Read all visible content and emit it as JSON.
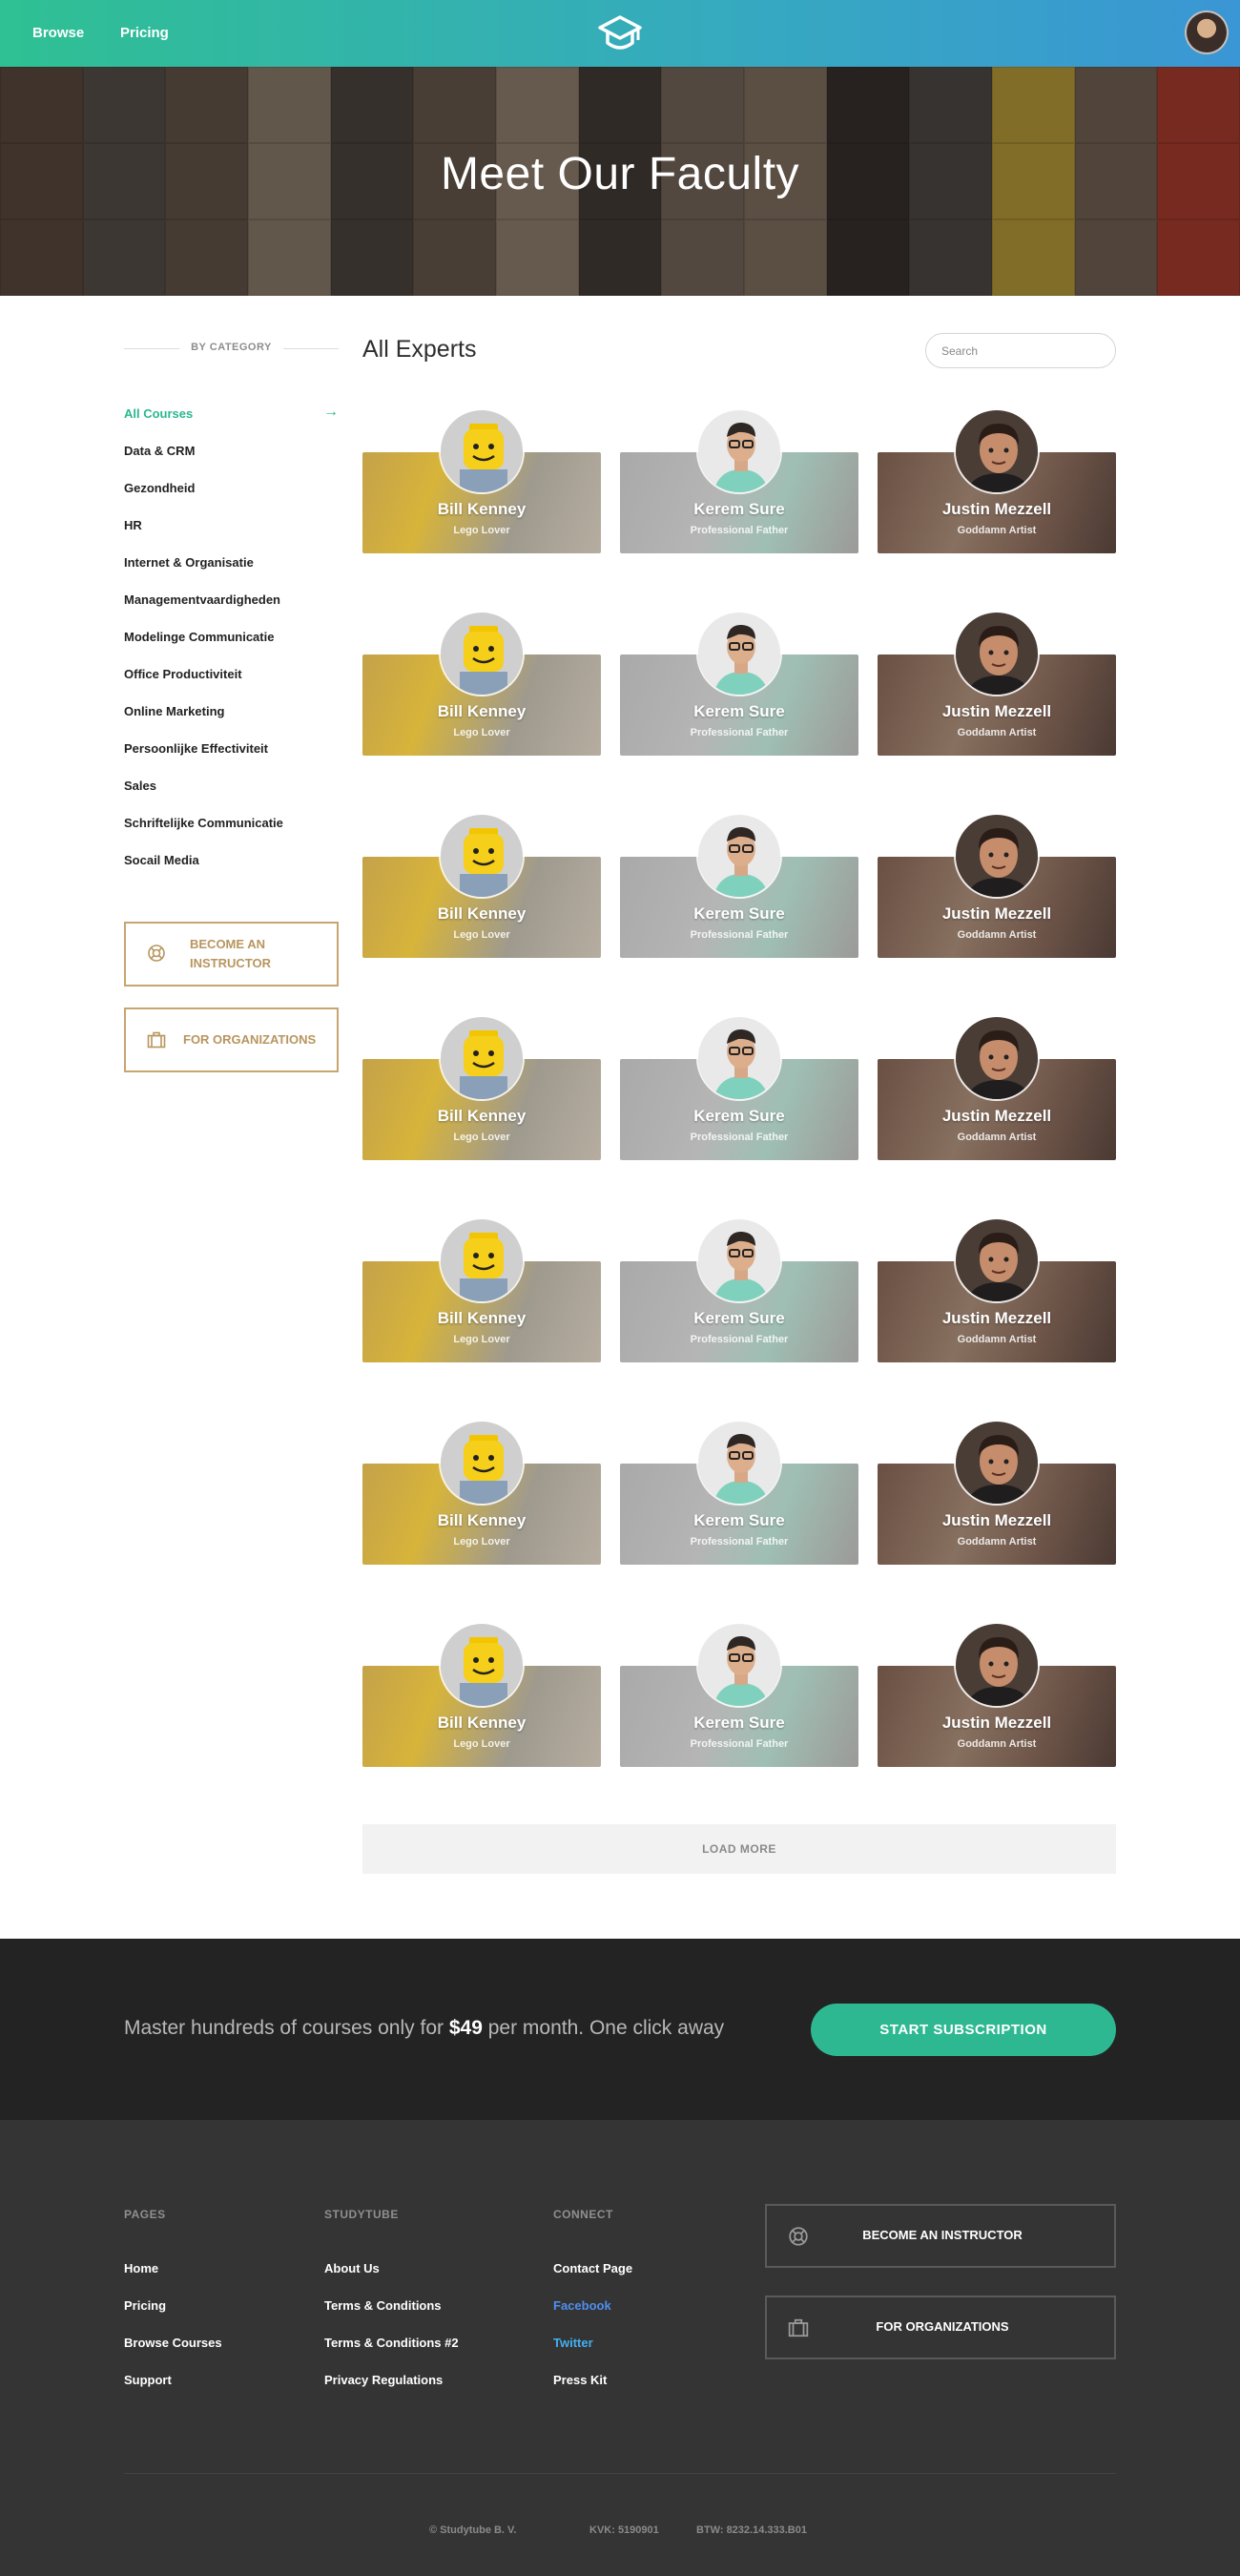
{
  "nav": {
    "browse_label": "Browse",
    "pricing_label": "Pricing",
    "logo_icon": "graduation-cap-icon",
    "colors": {
      "gradient_start": "#2fc093",
      "gradient_end": "#3a96d4"
    }
  },
  "hero": {
    "title": "Meet Our Faculty"
  },
  "sidebar": {
    "category_header": "BY CATEGORY",
    "categories": [
      {
        "label": "All Courses",
        "active": true
      },
      {
        "label": "Data & CRM"
      },
      {
        "label": "Gezondheid"
      },
      {
        "label": "HR"
      },
      {
        "label": "Internet & Organisatie"
      },
      {
        "label": "Managementvaardigheden"
      },
      {
        "label": "Modelinge Communicatie"
      },
      {
        "label": "Office Productiviteit"
      },
      {
        "label": "Online Marketing"
      },
      {
        "label": "Persoonlijke Effectiviteit"
      },
      {
        "label": "Sales"
      },
      {
        "label": "Schriftelijke Communicatie"
      },
      {
        "label": "Socail Media"
      }
    ],
    "active_arrow": "→",
    "become_instructor_line1": "BECOME AN",
    "become_instructor_line2": "INSTRUCTOR",
    "for_organizations": "FOR ORGANIZATIONS",
    "accent_color": "#2ab890",
    "button_color": "#c8a570"
  },
  "main": {
    "title": "All Experts",
    "search_placeholder": "Search",
    "experts": [
      {
        "name": "Bill Kenney",
        "role": "Lego Lover",
        "theme": "yellow"
      },
      {
        "name": "Kerem Sure",
        "role": "Professional Father",
        "theme": "gray"
      },
      {
        "name": "Justin Mezzell",
        "role": "Goddamn Artist",
        "theme": "brown"
      }
    ],
    "rows": 7,
    "load_more": "LOAD MORE"
  },
  "subscribe": {
    "text_before": "Master hundreds of courses only for ",
    "price": "$49",
    "text_after": " per month. One click away",
    "button": "START SUBSCRIPTION",
    "button_color": "#2eb892"
  },
  "footer": {
    "pages": {
      "heading": "PAGES",
      "links": [
        "Home",
        "Pricing",
        "Browse Courses",
        "Support"
      ]
    },
    "studytube": {
      "heading": "STUDYTUBE",
      "links": [
        "About Us",
        "Terms & Conditions",
        "Terms & Conditions #2",
        "Privacy Regulations"
      ]
    },
    "connect": {
      "heading": "CONNECT",
      "links": [
        "Contact Page",
        "Facebook",
        "Twitter",
        "Press Kit"
      ]
    },
    "become_instructor": "BECOME AN INSTRUCTOR",
    "for_organizations": "FOR ORGANIZATIONS",
    "copyright": "© Studytube B. V.",
    "kvk": "KVK: 5190901",
    "btw": "BTW: 8232.14.333.B01",
    "link_colors": {
      "facebook": "#4f8ef0",
      "twitter": "#42b0f0"
    }
  }
}
